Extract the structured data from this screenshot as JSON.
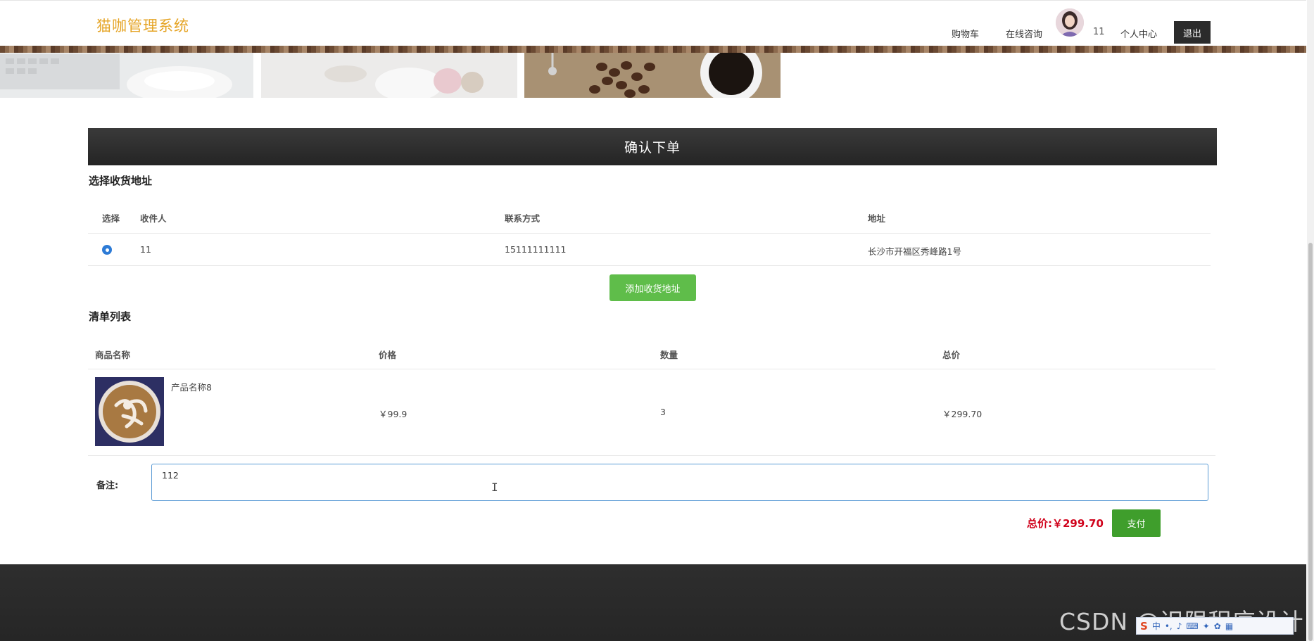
{
  "header": {
    "brand": "猫咖管理系统",
    "nav": {
      "cart": "购物车",
      "consult": "在线咨询",
      "username": "11",
      "profile": "个人中心",
      "logout": "退出"
    }
  },
  "order": {
    "title": "确认下单",
    "address_section_title": "选择收货地址",
    "address_columns": [
      "选择",
      "收件人",
      "联系方式",
      "地址"
    ],
    "addresses": [
      {
        "recipient": "11",
        "phone": "15111111111",
        "address": "长沙市开福区秀峰路1号",
        "selected": true
      }
    ],
    "add_address_label": "添加收货地址",
    "list_section_title": "清单列表",
    "item_columns": [
      "商品名称",
      "价格",
      "数量",
      "总价"
    ],
    "items": [
      {
        "name": "产品名称8",
        "price": "￥99.9",
        "quantity": "3",
        "subtotal": "￥299.70"
      }
    ],
    "remark_label": "备注:",
    "remark_value": "112",
    "total_label": "总价:",
    "total_value": "￥299.70",
    "pay_label": "支付"
  },
  "overlay": {
    "watermark": "CSDN @迟限程序设计",
    "ime_logo": "S",
    "ime_lang": "中"
  },
  "colors": {
    "brand": "#e5a425",
    "header_bar": "#2b2b2b",
    "add_button": "#5fbd4a",
    "pay_button": "#3f9e2c",
    "total_red": "#d0021b"
  }
}
